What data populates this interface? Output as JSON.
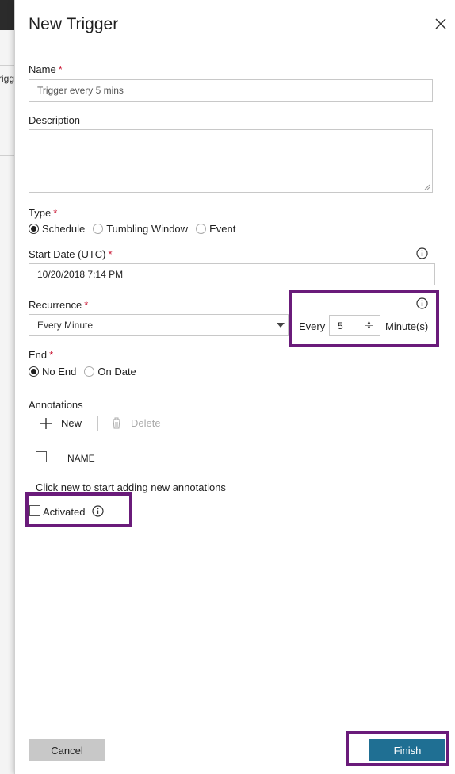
{
  "background": {
    "partial_tab_text": "rigg"
  },
  "dialog": {
    "title": "New Trigger",
    "name": {
      "label": "Name",
      "required": "*",
      "value": "Trigger every 5 mins"
    },
    "description": {
      "label": "Description",
      "value": ""
    },
    "type": {
      "label": "Type",
      "required": "*",
      "options": [
        "Schedule",
        "Tumbling Window",
        "Event"
      ],
      "selected": "Schedule"
    },
    "start_date": {
      "label": "Start Date (UTC)",
      "required": "*",
      "value": "10/20/2018 7:14 PM"
    },
    "recurrence": {
      "label": "Recurrence",
      "required": "*",
      "selected": "Every Minute",
      "every_label": "Every",
      "interval_value": "5",
      "unit_label": "Minute(s)"
    },
    "end": {
      "label": "End",
      "required": "*",
      "options": [
        "No End",
        "On Date"
      ],
      "selected": "No End"
    },
    "annotations": {
      "label": "Annotations",
      "new_label": "New",
      "delete_label": "Delete",
      "column_name": "NAME",
      "empty_message": "Click new to start adding new annotations"
    },
    "activated": {
      "label": "Activated",
      "checked": false
    },
    "cancel_label": "Cancel",
    "finish_label": "Finish"
  },
  "colors": {
    "highlight": "#6a1b7a",
    "primary_button": "#1f6f93",
    "required_asterisk": "#c8102e"
  }
}
